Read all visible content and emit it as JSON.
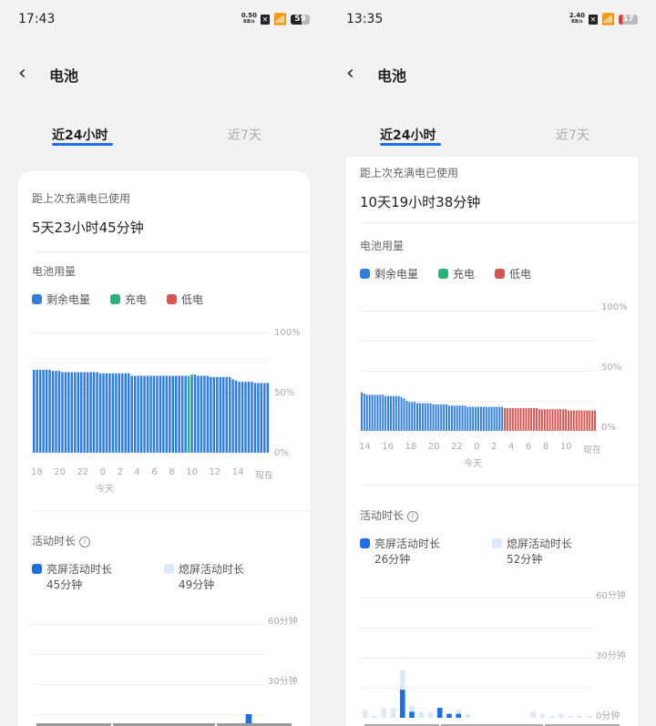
{
  "colors": {
    "remaining": "#2f7de1",
    "charging": "#27b37b",
    "low": "#d9534f",
    "screen_on": "#1e6fe6",
    "screen_off": "#dde8fb"
  },
  "left": {
    "status": {
      "time": "17:43",
      "net_speed": "0.50",
      "net_unit": "KB/s",
      "battery": "59"
    },
    "header": {
      "title": "电池",
      "back_icon": "chevron-left"
    },
    "tabs": [
      {
        "label": "近24小时",
        "active": true
      },
      {
        "label": "近7天",
        "active": false
      }
    ],
    "since_full_label": "距上次充满电已使用",
    "since_full_value": "5天23小时45分钟",
    "usage_title": "电池用量",
    "legend": [
      "剩余电量",
      "充电",
      "低电"
    ],
    "activity_title": "活动时长",
    "screen_on_label": "亮屏活动时长",
    "screen_on_value": "45分钟",
    "screen_off_label": "熄屏活动时长",
    "screen_off_value": "49分钟"
  },
  "right": {
    "status": {
      "time": "13:35",
      "net_speed": "2.40",
      "net_unit": "KB/s",
      "battery": "17"
    },
    "header": {
      "title": "电池",
      "back_icon": "chevron-left"
    },
    "tabs": [
      {
        "label": "近24小时",
        "active": true
      },
      {
        "label": "近7天",
        "active": false
      }
    ],
    "since_full_label": "距上次充满电已使用",
    "since_full_value": "10天19小时38分钟",
    "usage_title": "电池用量",
    "legend": [
      "剩余电量",
      "充电",
      "低电"
    ],
    "activity_title": "活动时长",
    "screen_on_label": "亮屏活动时长",
    "screen_on_value": "26分钟",
    "screen_off_label": "熄屏活动时长",
    "screen_off_value": "52分钟"
  },
  "chart_data": [
    {
      "type": "bar",
      "title": "电池用量 (left)",
      "ylabel": "%",
      "ylim": [
        0,
        100
      ],
      "y_ticks": [
        "100%",
        "50%",
        "0%"
      ],
      "x_ticks": [
        "18",
        "20",
        "22",
        "0",
        "2",
        "4",
        "6",
        "8",
        "10",
        "12",
        "14",
        "现在"
      ],
      "x_sublabel": "今天",
      "values": [
        69,
        69,
        69,
        69,
        69,
        69,
        68,
        68,
        68,
        67,
        67,
        67,
        67,
        67,
        67,
        67,
        67,
        67,
        67,
        67,
        67,
        66,
        66,
        66,
        66,
        66,
        66,
        66,
        66,
        66,
        66,
        64,
        64,
        64,
        64,
        64,
        64,
        64,
        64,
        64,
        64,
        64,
        64,
        64,
        64,
        64,
        64,
        64,
        64,
        64,
        65,
        65,
        64,
        64,
        64,
        64,
        63,
        63,
        63,
        63,
        63,
        63,
        63,
        61,
        60,
        59,
        59,
        59,
        59,
        59,
        58,
        58,
        58,
        58,
        58
      ],
      "charging_index": [
        49
      ]
    },
    {
      "type": "bar",
      "title": "电池用量 (right)",
      "ylabel": "%",
      "ylim": [
        0,
        100
      ],
      "y_ticks": [
        "100%",
        "50%",
        "0%"
      ],
      "x_ticks": [
        "14",
        "16",
        "18",
        "20",
        "22",
        "0",
        "2",
        "4",
        "6",
        "8",
        "10",
        "现在"
      ],
      "x_sublabel": "今天",
      "values": [
        32,
        31,
        30,
        30,
        30,
        30,
        30,
        30,
        30,
        29,
        29,
        29,
        29,
        29,
        29,
        28,
        27,
        25,
        24,
        24,
        24,
        23,
        23,
        23,
        23,
        23,
        23,
        22,
        22,
        22,
        22,
        22,
        22,
        21,
        21,
        21,
        21,
        21,
        21,
        21,
        20,
        20,
        20,
        20,
        20,
        20,
        20,
        20,
        20,
        20,
        20,
        20,
        20,
        20,
        19,
        19,
        19,
        19,
        19,
        19,
        19,
        19,
        19,
        19,
        19,
        19,
        19,
        18,
        18,
        18,
        18,
        18,
        18,
        18,
        18,
        18,
        18,
        18,
        17,
        17,
        17,
        17,
        17,
        17,
        17,
        17,
        17,
        17,
        17
      ],
      "low_threshold": 20
    },
    {
      "type": "bar",
      "title": "活动时长 (left)",
      "y_ticks": [
        "60分钟",
        "30分钟"
      ],
      "ylim": [
        0,
        60
      ],
      "screen_on": [
        0,
        0,
        0,
        0,
        0,
        0,
        0,
        0,
        0,
        0,
        0,
        0,
        0,
        0,
        0,
        0,
        1,
        0,
        0,
        15,
        1
      ],
      "screen_off": [
        0,
        1,
        0,
        0,
        0,
        0,
        0,
        0,
        0,
        0,
        0,
        0,
        0,
        0,
        0,
        0,
        6,
        0,
        0,
        2,
        5
      ]
    },
    {
      "type": "bar",
      "title": "活动时长 (right)",
      "y_ticks": [
        "60分钟",
        "30分钟",
        "0分钟"
      ],
      "ylim": [
        0,
        60
      ],
      "screen_on": [
        0,
        0,
        0,
        0,
        14,
        3,
        0,
        0,
        5,
        2,
        2,
        0,
        0,
        0,
        0,
        0,
        0,
        0,
        0,
        0,
        0,
        0,
        0,
        0,
        0
      ],
      "screen_off": [
        4,
        1,
        5,
        5,
        24,
        6,
        3,
        3,
        5,
        2,
        4,
        2,
        0,
        0,
        0,
        0,
        0,
        0,
        3,
        2,
        1,
        2,
        1,
        1,
        1
      ]
    }
  ]
}
